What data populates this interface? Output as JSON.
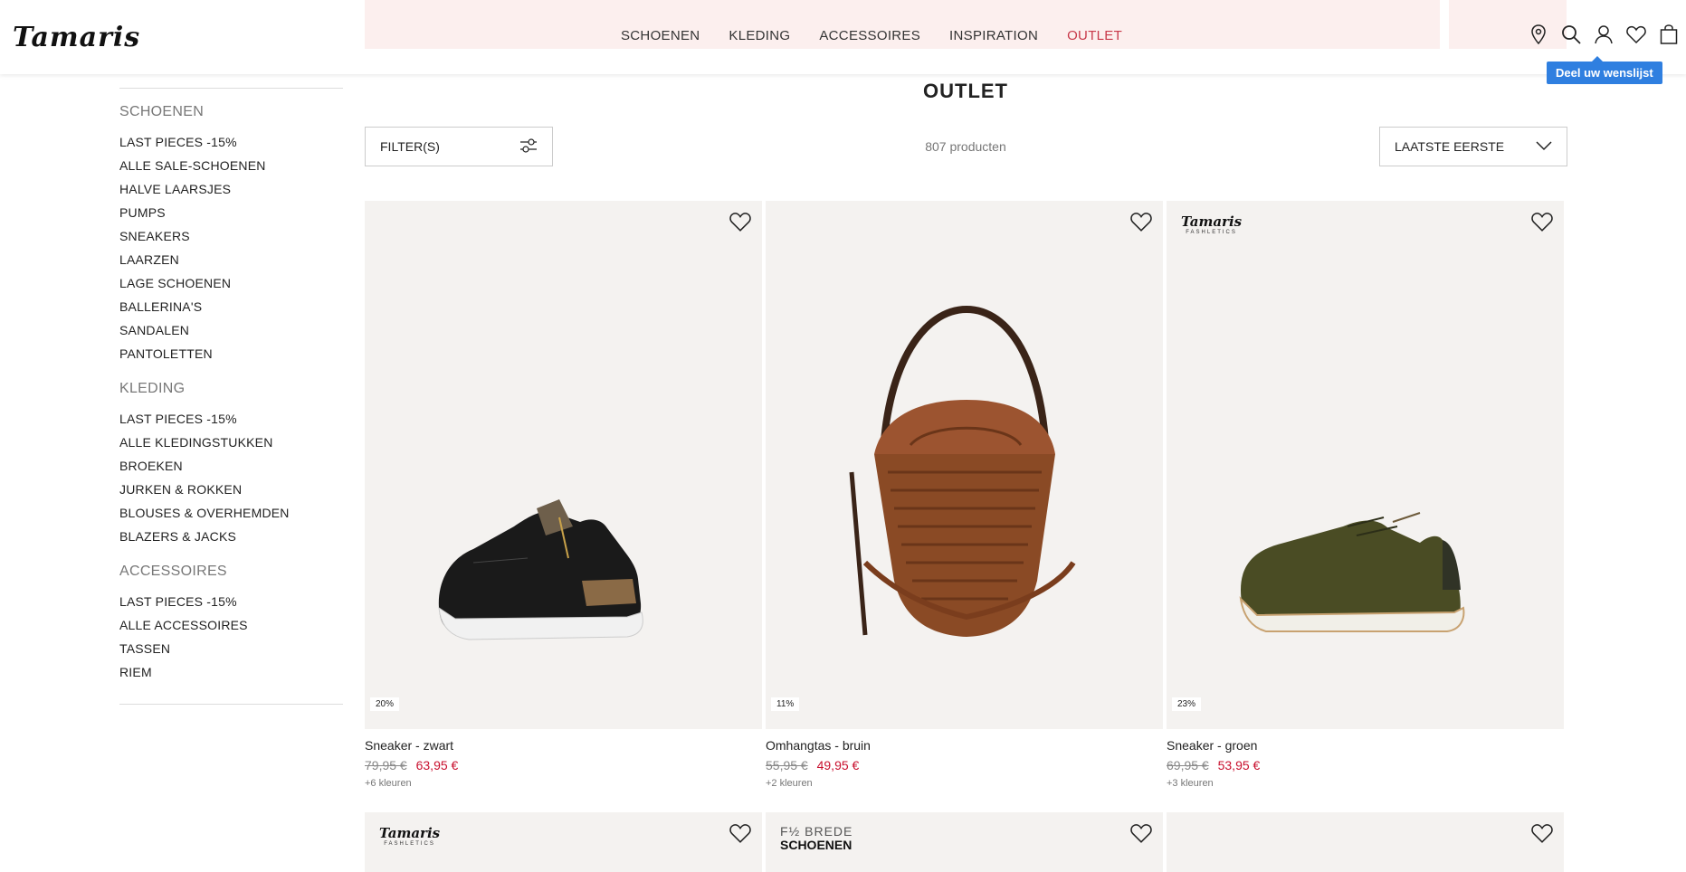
{
  "brand": {
    "logo": "Tamaris"
  },
  "nav": {
    "items": [
      "SCHOENEN",
      "KLEDING",
      "ACCESSOIRES",
      "INSPIRATION",
      "OUTLET"
    ]
  },
  "header_icons": [
    "location-icon",
    "search-icon",
    "account-icon",
    "heart-icon",
    "bag-icon"
  ],
  "tooltip": "Deel uw wenslijst",
  "sidebar": {
    "sections": [
      {
        "title": "SCHOENEN",
        "items": [
          "LAST PIECES -15%",
          "ALLE SALE-SCHOENEN",
          "HALVE LAARSJES",
          "PUMPS",
          "SNEAKERS",
          "LAARZEN",
          "LAGE SCHOENEN",
          "BALLERINA'S",
          "SANDALEN",
          "PANTOLETTEN"
        ]
      },
      {
        "title": "KLEDING",
        "items": [
          "LAST PIECES -15%",
          "ALLE KLEDINGSTUKKEN",
          "BROEKEN",
          "JURKEN & ROKKEN",
          "BLOUSES & OVERHEMDEN",
          "BLAZERS & JACKS"
        ]
      },
      {
        "title": "ACCESSOIRES",
        "items": [
          "LAST PIECES -15%",
          "ALLE ACCESSOIRES",
          "TASSEN",
          "RIEM"
        ]
      }
    ]
  },
  "main": {
    "title": "OUTLET",
    "filter_label": "FILTER(S)",
    "count": "807 producten",
    "sort_label": "LAATSTE EERSTE"
  },
  "products": [
    {
      "name": "Sneaker - zwart",
      "old_price": "79,95 €",
      "new_price": "63,95 €",
      "colors": "+6 kleuren",
      "badge": "20%"
    },
    {
      "name": "Omhangtas - bruin",
      "old_price": "55,95 €",
      "new_price": "49,95 €",
      "colors": "+2 kleuren",
      "badge": "11%"
    },
    {
      "name": "Sneaker - groen",
      "old_price": "69,95 €",
      "new_price": "53,95 €",
      "colors": "+3 kleuren",
      "badge": "23%"
    }
  ],
  "brandmarks": {
    "fashletics_top": "Tamaris",
    "fashletics_sub": "FASHLETICS",
    "wide_top": "F½ BREDE",
    "wide_bottom": "SCHOENEN"
  },
  "colors": {
    "accent": "#c8394a",
    "price_red": "#c8102e",
    "tooltip_blue": "#2f7fe0",
    "promo_pink": "#fcefee",
    "card_bg": "#f4f2f0"
  }
}
